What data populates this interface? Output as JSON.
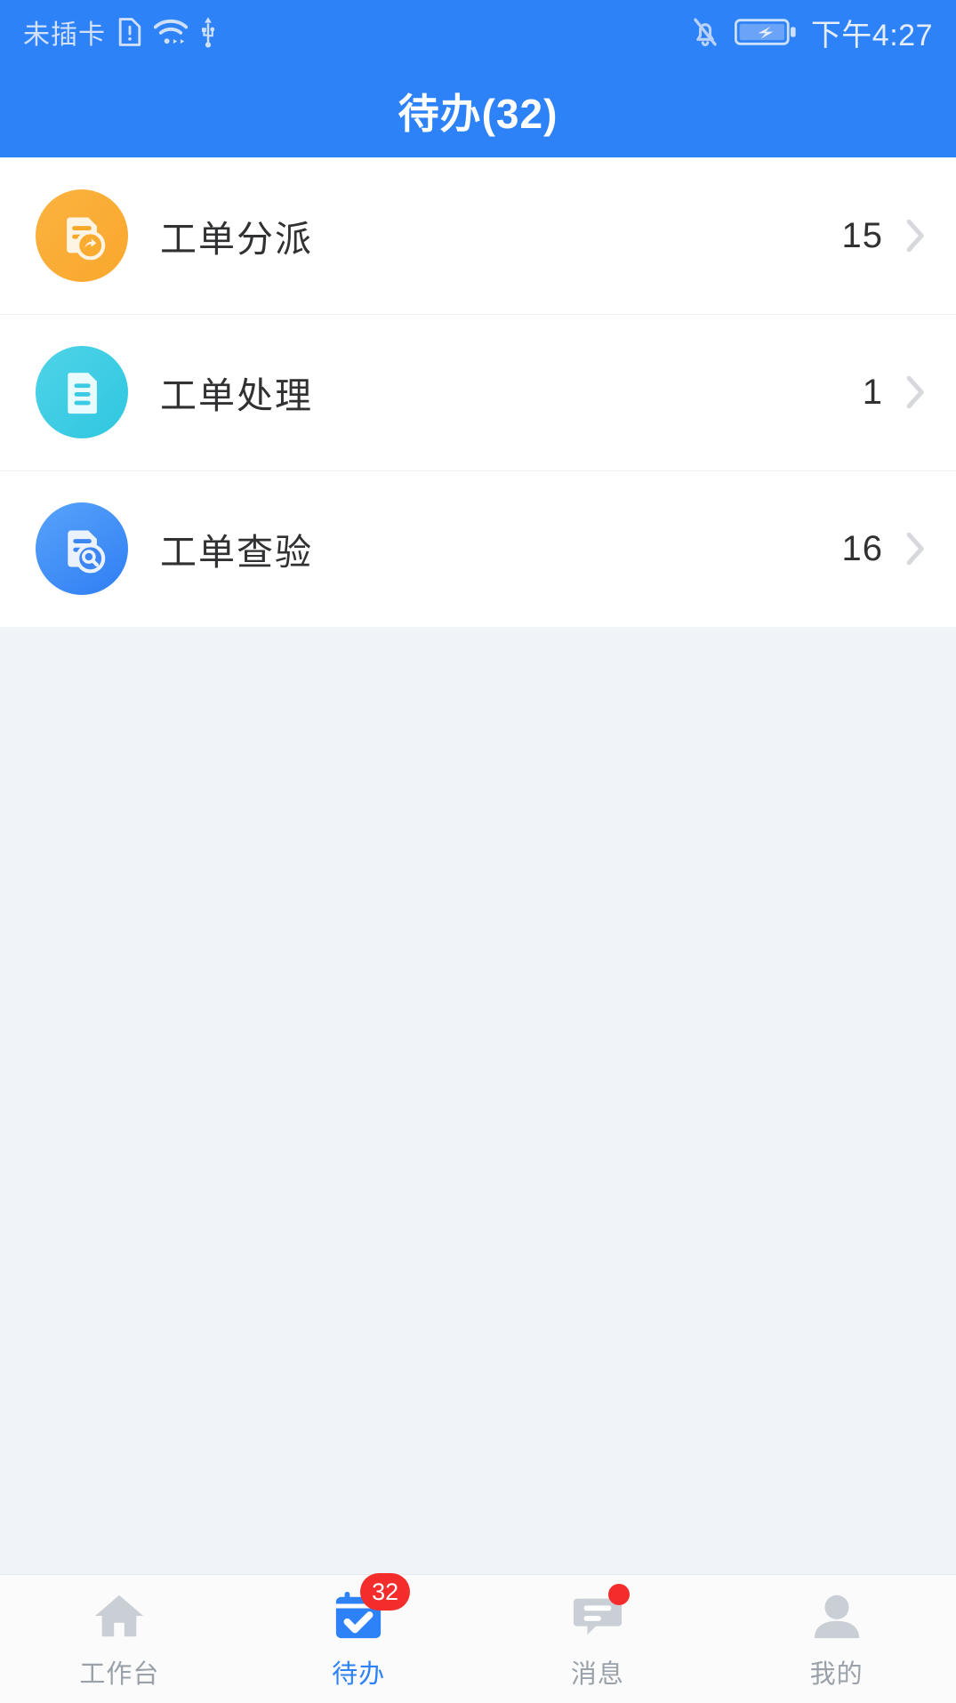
{
  "status_bar": {
    "carrier_text": "未插卡",
    "sim_alert_icon": "sim-alert-icon",
    "wifi_icon": "wifi-icon",
    "usb_icon": "usb-icon",
    "bell_muted_icon": "bell-muted-icon",
    "battery_charging_icon": "battery-charging-icon",
    "time": "下午4:27"
  },
  "header": {
    "title": "待办(32)",
    "background_color": "#2e82f7"
  },
  "list": {
    "items": [
      {
        "label": "工单分派",
        "count": "15",
        "icon": "work-order-assign-icon",
        "icon_color": "#f9ac30",
        "chevron": "chevron-right-icon"
      },
      {
        "label": "工单处理",
        "count": "1",
        "icon": "work-order-process-icon",
        "icon_color": "#3bcbe3",
        "chevron": "chevron-right-icon"
      },
      {
        "label": "工单查验",
        "count": "16",
        "icon": "work-order-inspect-icon",
        "icon_color": "#3b85f5",
        "chevron": "chevron-right-icon"
      }
    ]
  },
  "tabbar": {
    "items": [
      {
        "label": "工作台",
        "icon": "home-icon",
        "active": false,
        "badge": ""
      },
      {
        "label": "待办",
        "icon": "calendar-check-icon",
        "active": true,
        "badge": "32"
      },
      {
        "label": "消息",
        "icon": "message-icon",
        "active": false,
        "badge": "dot"
      },
      {
        "label": "我的",
        "icon": "person-icon",
        "active": false,
        "badge": ""
      }
    ],
    "active_color": "#2e82f7",
    "inactive_color": "#9aa1a8",
    "badge_color": "#f42c2c"
  }
}
